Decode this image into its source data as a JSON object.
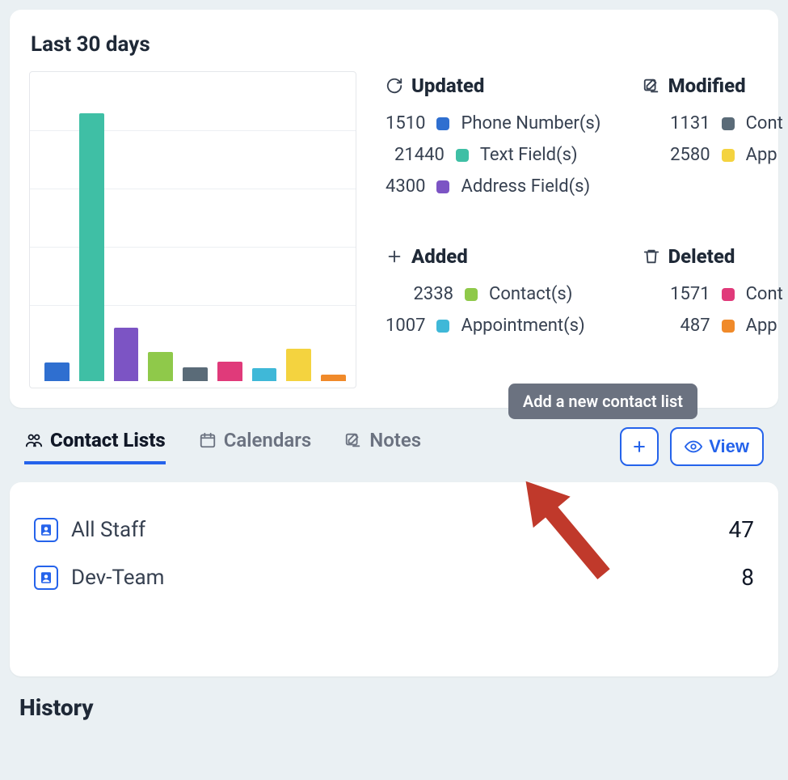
{
  "dashboard": {
    "title": "Last 30 days",
    "groups": [
      {
        "icon": "refresh-icon",
        "title": "Updated",
        "items": [
          {
            "value": 1510,
            "color": "#2f6fd0",
            "label": "Phone Number(s)"
          },
          {
            "value": 21440,
            "color": "#3fbfa5",
            "label": "Text Field(s)"
          },
          {
            "value": 4300,
            "color": "#7c54c4",
            "label": "Address Field(s)"
          }
        ]
      },
      {
        "icon": "edit-square-icon",
        "title": "Modified",
        "items": [
          {
            "value": 1131,
            "color": "#5a6b78",
            "label": "Cont"
          },
          {
            "value": 2580,
            "color": "#f4d33f",
            "label": "App"
          }
        ]
      },
      {
        "icon": "plus-icon",
        "title": "Added",
        "items": [
          {
            "value": 2338,
            "color": "#8fc94a",
            "label": "Contact(s)"
          },
          {
            "value": 1007,
            "color": "#3fb8d8",
            "label": "Appointment(s)"
          }
        ]
      },
      {
        "icon": "trash-icon",
        "title": "Deleted",
        "items": [
          {
            "value": 1571,
            "color": "#e03a7a",
            "label": "Cont"
          },
          {
            "value": 487,
            "color": "#f08a2a",
            "label": "App"
          }
        ]
      }
    ]
  },
  "chart_data": {
    "type": "bar",
    "title": "Last 30 days",
    "xlabel": "",
    "ylabel": "",
    "ylim": [
      0,
      22000
    ],
    "grid": true,
    "categories": [
      "Phone Number(s)",
      "Text Field(s)",
      "Address Field(s)",
      "Contact(s)",
      "Cont (Modified)",
      "Cont (Deleted)",
      "Appointment(s)",
      "App (Modified)",
      "App (Deleted)"
    ],
    "series": [
      {
        "name": "value",
        "values": [
          1510,
          21440,
          4300,
          2338,
          1131,
          1571,
          1007,
          2580,
          487
        ]
      }
    ],
    "colors": [
      "#2f6fd0",
      "#3fbfa5",
      "#7c54c4",
      "#8fc94a",
      "#5a6b78",
      "#e03a7a",
      "#3fb8d8",
      "#f4d33f",
      "#f08a2a"
    ]
  },
  "tabs": {
    "items": [
      {
        "icon": "people-icon",
        "label": "Contact Lists",
        "active": true
      },
      {
        "icon": "calendar-icon",
        "label": "Calendars",
        "active": false
      },
      {
        "icon": "edit-square-icon",
        "label": "Notes",
        "active": false
      }
    ],
    "add_tooltip": "Add a new contact list",
    "view_label": "View"
  },
  "contact_lists": [
    {
      "name": "All Staff",
      "count": 47
    },
    {
      "name": "Dev-Team",
      "count": 8
    }
  ],
  "history_title": "History",
  "colors": {
    "accent": "#2563eb"
  }
}
